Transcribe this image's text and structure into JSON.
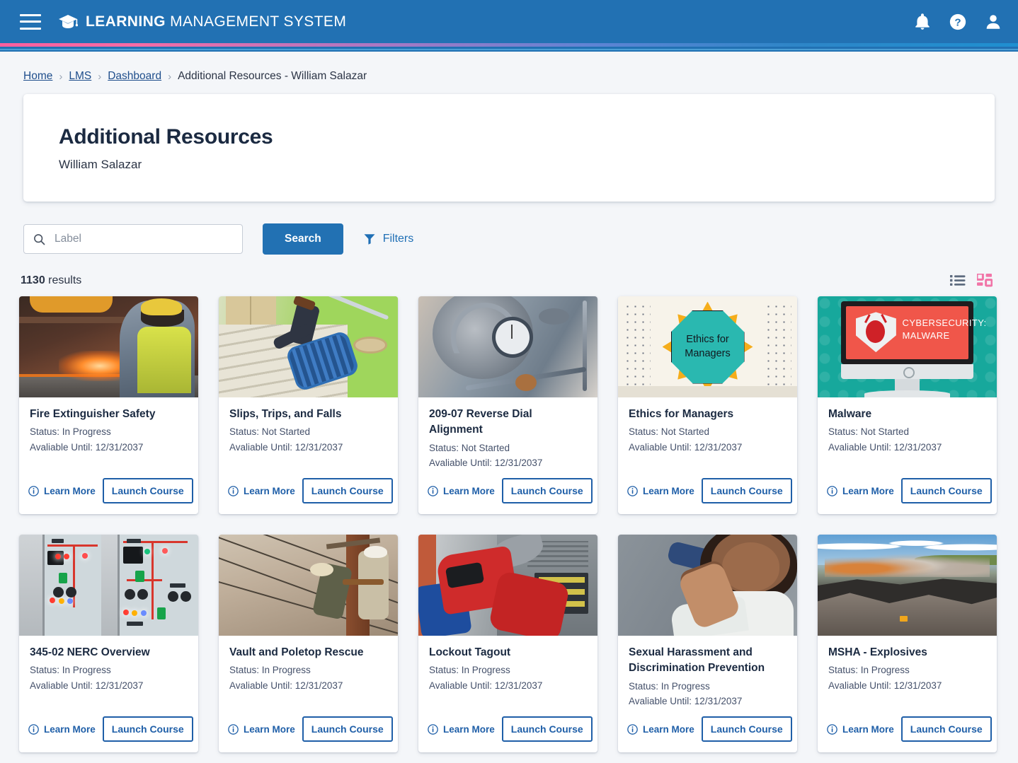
{
  "header": {
    "menu_label": "Menu",
    "brand_bold": "LEARNING",
    "brand_light": " MANAGEMENT SYSTEM",
    "icons": [
      "notifications-bell",
      "help-question",
      "user-profile"
    ],
    "bg_color": "#2271b3",
    "accent_pink": "#ff5f9e"
  },
  "breadcrumb": {
    "items": [
      {
        "label": "Home",
        "link": true
      },
      {
        "label": "LMS",
        "link": true
      },
      {
        "label": "Dashboard",
        "link": true
      },
      {
        "label": "Additional Resources - William Salazar",
        "link": false
      }
    ],
    "separator": "›"
  },
  "page": {
    "title": "Additional Resources",
    "subtitle": "William Salazar"
  },
  "search": {
    "placeholder": "Label",
    "value": "",
    "search_button": "Search",
    "filters_label": "Filters"
  },
  "results": {
    "count": "1130",
    "count_suffix": " results",
    "view_list_label": "List view",
    "view_grid_label": "Grid view",
    "active_view": "grid",
    "grid_icon_color": "#f175a8",
    "list_icon_color": "#5d6b7f"
  },
  "labels": {
    "status_prefix": "Status: ",
    "available_prefix": "Avaliable Until: ",
    "learn_more": "Learn More",
    "launch_course": "Launch Course"
  },
  "cards": [
    {
      "title": "Fire Extinguisher Safety",
      "status": "Status: In Progress",
      "available": "Avaliable Until: 12/31/2037",
      "learn_more": "Learn More",
      "launch": "Launch Course",
      "thumb": "fire-extinguisher-industrial-photo"
    },
    {
      "title": "Slips, Trips, and Falls",
      "status": "Status: Not Started",
      "available": "Avaliable Until: 12/31/2037",
      "learn_more": "Learn More",
      "launch": "Launch Course",
      "thumb": "person-falling-stairs-photo"
    },
    {
      "title": "209-07 Reverse Dial Alignment",
      "status": "Status: Not Started",
      "available": "Avaliable Until: 12/31/2037",
      "learn_more": "Learn More",
      "launch": "Launch Course",
      "thumb": "dial-indicator-machine-photo"
    },
    {
      "title": "Ethics for Managers",
      "status": "Status: Not Started",
      "available": "Avaliable Until: 12/31/2037",
      "learn_more": "Learn More",
      "launch": "Launch Course",
      "thumb": "ethics-octagon-graphic",
      "thumb_text_line1": "Ethics for",
      "thumb_text_line2": "Managers"
    },
    {
      "title": "Malware",
      "status": "Status: Not Started",
      "available": "Avaliable Until: 12/31/2037",
      "learn_more": "Learn More",
      "launch": "Launch Course",
      "thumb": "cybersecurity-malware-graphic",
      "thumb_text_line1": "CYBERSECURITY:",
      "thumb_text_line2": "MALWARE"
    },
    {
      "title": "345-02 NERC Overview",
      "status": "Status: In Progress",
      "available": "Avaliable Until: 12/31/2037",
      "learn_more": "Learn More",
      "launch": "Launch Course",
      "thumb": "electrical-switchgear-panels-photo"
    },
    {
      "title": "Vault and Poletop Rescue",
      "status": "Status: In Progress",
      "available": "Avaliable Until: 12/31/2037",
      "learn_more": "Learn More",
      "launch": "Launch Course",
      "thumb": "linemen-utility-pole-photo"
    },
    {
      "title": "Lockout Tagout",
      "status": "Status: In Progress",
      "available": "Avaliable Until: 12/31/2037",
      "learn_more": "Learn More",
      "launch": "Launch Course",
      "thumb": "lockout-device-electrical-panel-photo"
    },
    {
      "title": "Sexual Harassment and Discrimination Prevention",
      "status": "Status: In Progress",
      "available": "Avaliable Until: 12/31/2037",
      "learn_more": "Learn More",
      "launch": "Launch Course",
      "thumb": "unwanted-touch-workplace-photo"
    },
    {
      "title": "MSHA - Explosives",
      "status": "Status: In Progress",
      "available": "Avaliable Until: 12/31/2037",
      "learn_more": "Learn More",
      "launch": "Launch Course",
      "thumb": "mine-blasting-explosion-photo"
    }
  ]
}
